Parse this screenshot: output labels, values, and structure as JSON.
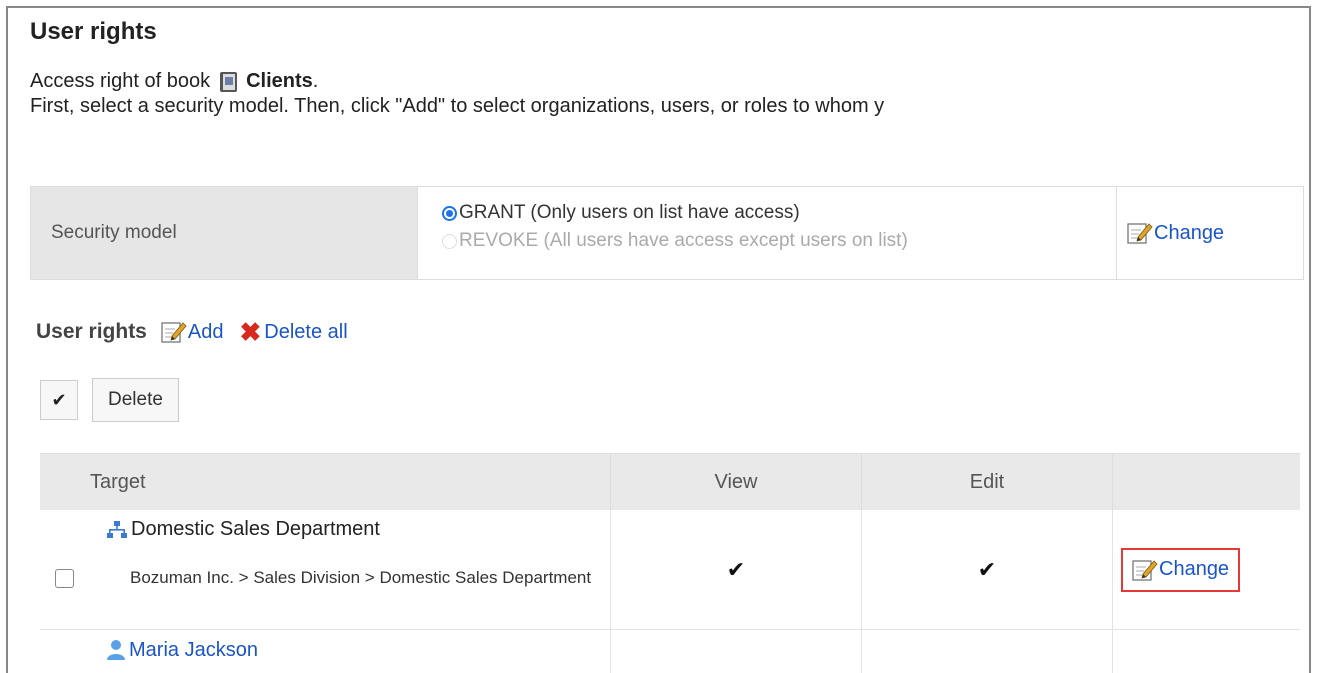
{
  "header": {
    "title": "User rights",
    "access_prefix": "Access right of book",
    "book_name": "Clients",
    "access_suffix": ".",
    "instruction": "First, select a security model. Then, click \"Add\" to select organizations, users, or roles to whom y"
  },
  "security_model": {
    "label": "Security model",
    "options": [
      {
        "label": "GRANT (Only users on list have access)",
        "selected": true
      },
      {
        "label": "REVOKE (All users have access except users on list)",
        "selected": false
      }
    ],
    "change_label": "Change"
  },
  "user_rights": {
    "title": "User rights",
    "add_label": "Add",
    "delete_all_label": "Delete all",
    "toggle_all_glyph": "✔",
    "delete_button": "Delete"
  },
  "table": {
    "columns": [
      "Target",
      "View",
      "Edit",
      ""
    ],
    "rows": [
      {
        "name": "Domestic Sales Department",
        "path": "Bozuman Inc. > Sales Division > Domestic Sales Department",
        "view": "✔",
        "edit": "✔",
        "action": "Change"
      },
      {
        "name": "Maria Jackson"
      }
    ]
  },
  "colors": {
    "link": "#1a55c8",
    "highlight": "#e53935",
    "header_bg": "#e9e9e9"
  },
  "icons": [
    "book-icon",
    "edit-icon",
    "delete-icon",
    "organization-icon",
    "user-icon"
  ]
}
